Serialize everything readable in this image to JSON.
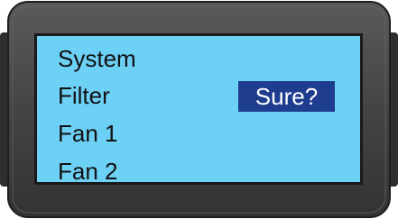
{
  "menu": {
    "items": [
      {
        "label": "System"
      },
      {
        "label": "Filter"
      },
      {
        "label": "Fan 1"
      },
      {
        "label": "Fan 2"
      }
    ]
  },
  "confirm": {
    "label": "Sure?"
  },
  "colors": {
    "bezel": "#4a4a4a",
    "screen_background": "#6dd0f5",
    "highlight": "#1f3d8f",
    "highlight_text": "#ffffff",
    "text": "#111111"
  }
}
